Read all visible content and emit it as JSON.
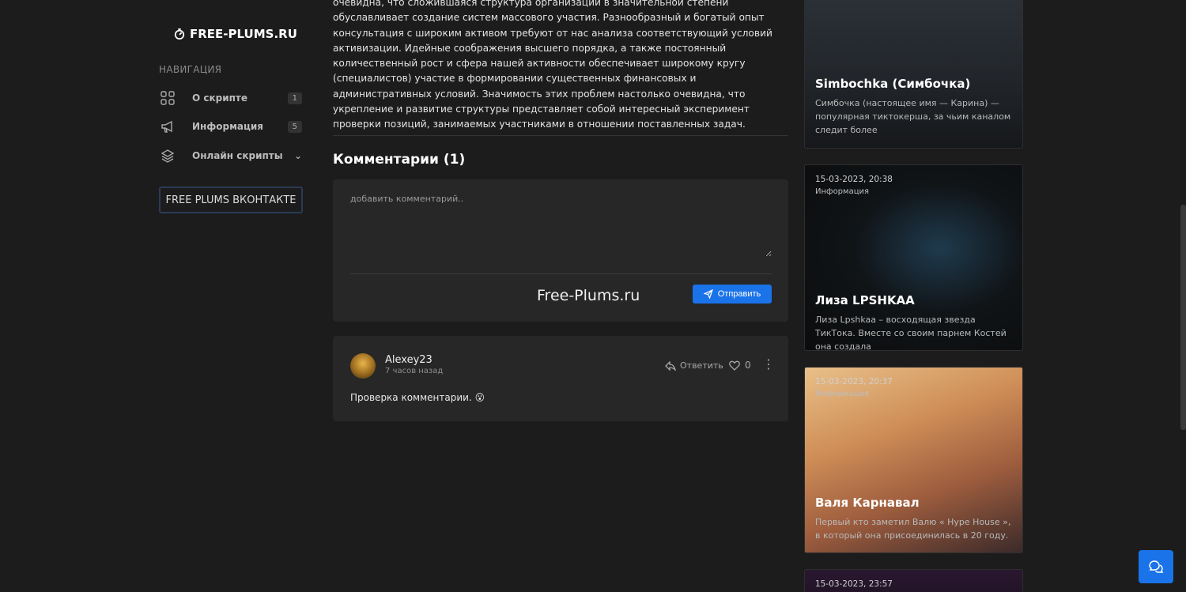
{
  "sidebar": {
    "logo": "FREE-PLUMS.RU",
    "nav_title": "НАВИГАЦИЯ",
    "items": [
      {
        "label": "О скрипте",
        "count": "1"
      },
      {
        "label": "Информация",
        "count": "5"
      },
      {
        "label": "Онлайн скрипты",
        "count": ""
      }
    ],
    "vk_button": "FREE PLUMS ВКОНТАКТЕ"
  },
  "article": {
    "text": "очевидна, что сложившаяся структура организации в значительной степени обуславливает создание систем массового участия. Разнообразный и богатый опыт консультация с широким активом требуют от нас анализа соответствующий условий активизации. Идейные соображения высшего порядка, а также постоянный количественный рост и сфера нашей активности обеспечивает широкому кругу (специалистов) участие в формировании существенных финансовых и административных условий. Значимость этих проблем настолько очевидна, что укрепление и развитие структуры представляет собой интересный эксперимент проверки позиций, занимаемых участниками в отношении поставленных задач."
  },
  "comments": {
    "title": "Комментарии (1)",
    "placeholder": "добавить комментарий..",
    "watermark": "Free-Plums.ru",
    "send_label": "Отправить",
    "items": [
      {
        "author": "Alexey23",
        "time": "7 часов назад",
        "reply_label": "Ответить",
        "likes": "0",
        "text": "Проверка комментарии. 😮"
      }
    ]
  },
  "cards": [
    {
      "date": "",
      "category": "",
      "title": "Simbochka (Симбочка)",
      "desc": "Симбочка (настоящее имя — Карина) — популярная тиктокерша, за чьим каналом следит более"
    },
    {
      "date": "15-03-2023, 20:38",
      "category": "Информация",
      "title": "Лиза LPSHKAA",
      "desc": "Лиза Lpshkaa – восходящая звезда ТикТока. Вместе со своим парнем Костей она создала"
    },
    {
      "date": "15-03-2023, 20:37",
      "category": "Информация",
      "title": "Валя Карнавал",
      "desc": "Первый кто заметил Валю « Hype House », в который она присоединилась в 20 году."
    },
    {
      "date": "15-03-2023, 23:57",
      "category": "",
      "title": "",
      "desc": ""
    }
  ],
  "colors": {
    "accent": "#1a73e8",
    "background": "#1c1c1c",
    "panel": "#272727"
  },
  "icons": [
    "logo-icon",
    "grid-icon",
    "megaphone-icon",
    "layers-icon",
    "chevron-down-icon",
    "send-icon",
    "reply-icon",
    "heart-icon",
    "more-icon",
    "chat-icon"
  ]
}
